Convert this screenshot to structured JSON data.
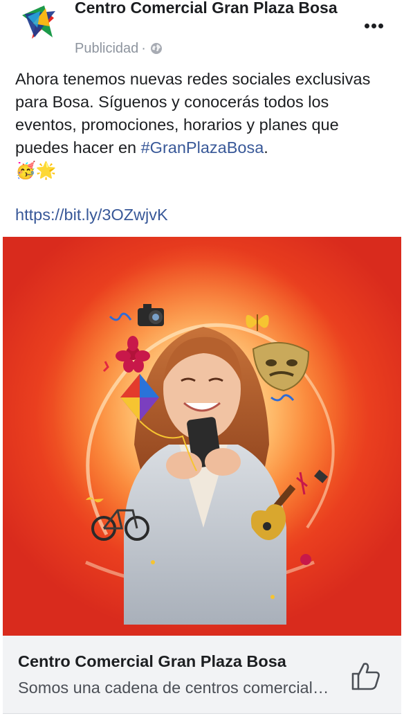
{
  "post": {
    "page_name": "Centro Comercial Gran Plaza Bosa",
    "meta_label": "Publicidad",
    "meta_separator": "·",
    "privacy_icon": "globe-icon",
    "more_icon": "more-options-icon",
    "text_before_hashtag": "Ahora tenemos nuevas redes sociales exclusivas para Bosa. Síguenos y conocerás todos los eventos, promociones, horarios y planes que puedes hacer en ",
    "hashtag": "#GranPlazaBosa",
    "text_after_hashtag": ".",
    "emojis": "🥳🌟",
    "link": "https://bit.ly/3OZwjvK"
  },
  "colors": {
    "link": "#385898",
    "meta": "#8d949e",
    "card_background": "#f2f3f5",
    "media_red": "#e3331f",
    "media_orange": "#f9762b"
  },
  "link_card": {
    "title": "Centro Comercial Gran Plaza Bosa",
    "description": "Somos una cadena de centros comerciales",
    "like_icon": "thumbs-up-icon"
  }
}
